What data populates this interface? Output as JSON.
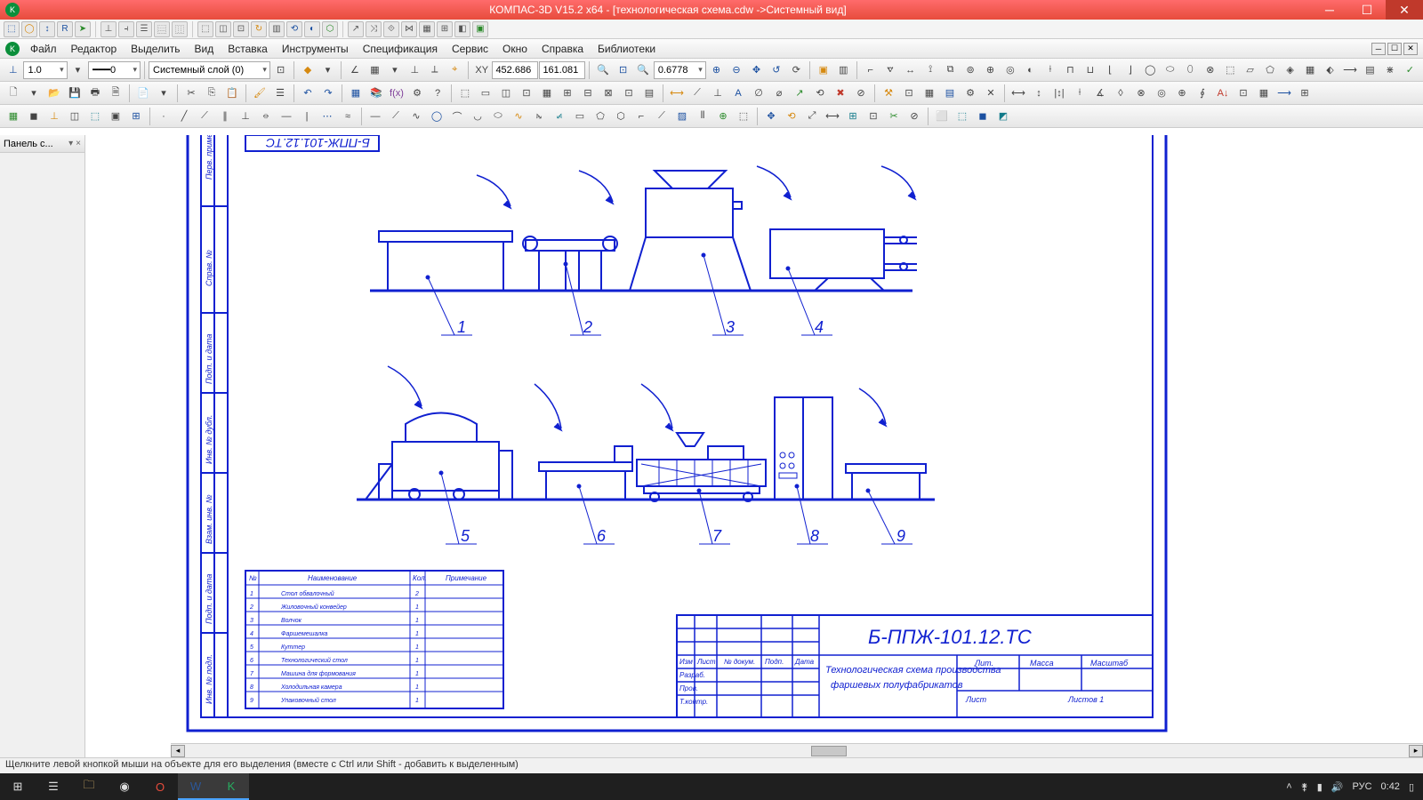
{
  "title": "КОМПАС-3D V15.2  x64 - [технологическая схема.cdw ->Системный вид]",
  "menus": [
    "Файл",
    "Редактор",
    "Выделить",
    "Вид",
    "Вставка",
    "Инструменты",
    "Спецификация",
    "Сервис",
    "Окно",
    "Справка",
    "Библиотеки"
  ],
  "props": {
    "lineweight": "1.0",
    "linetype": "0",
    "layer": "Системный слой (0)",
    "coord_x": "452.686",
    "coord_y": "161.081",
    "zoom": "0.6778"
  },
  "sidepanel": {
    "title": "Панель с...",
    "pin": "▾",
    "close": "×"
  },
  "status": "Щелкните левой кнопкой мыши на объекте для его выделения (вместе с Ctrl или Shift - добавить к выделенным)",
  "drawing": {
    "doc_code": "Б-ППЖ-101.12.ТС",
    "doc_title_1": "Технологическая схема производства",
    "doc_title_2": "фаршевых полуфабрикатов",
    "tb_cols": [
      "Изм",
      "Лист",
      "№ докум.",
      "Подп.",
      "Дата"
    ],
    "tb_rows": [
      "Разраб.",
      "Пров.",
      "Т.контр."
    ],
    "tb_right": [
      "Лит.",
      "Масса",
      "Масштаб",
      "Листов   1",
      "Лист"
    ],
    "toc_head": [
      "№",
      "Наименование",
      "Кол.",
      "Примечание"
    ],
    "toc_rows": [
      {
        "n": "1",
        "name": "Стол обвалочный",
        "q": "2"
      },
      {
        "n": "2",
        "name": "Жиловочный конвейер",
        "q": "1"
      },
      {
        "n": "3",
        "name": "Волчок",
        "q": "1"
      },
      {
        "n": "4",
        "name": "Фаршемешалка",
        "q": "1"
      },
      {
        "n": "5",
        "name": "Куттер",
        "q": "1"
      },
      {
        "n": "6",
        "name": "Технологический стол",
        "q": "1"
      },
      {
        "n": "7",
        "name": "Машина для формования",
        "q": "1"
      },
      {
        "n": "8",
        "name": "Холодильная камера",
        "q": "1"
      },
      {
        "n": "9",
        "name": "Упаковочный стол",
        "q": "1"
      }
    ],
    "side_labels": [
      "Перв. примен.",
      "Справ. №",
      "Подп. и дата",
      "Инв. № дубл.",
      "Взам. инв. №",
      "Подп. и дата",
      "Инв. № подл."
    ],
    "callouts": [
      "1",
      "2",
      "3",
      "4",
      "5",
      "6",
      "7",
      "8",
      "9"
    ]
  },
  "taskbar": {
    "lang": "РУС",
    "time": "0:42"
  }
}
